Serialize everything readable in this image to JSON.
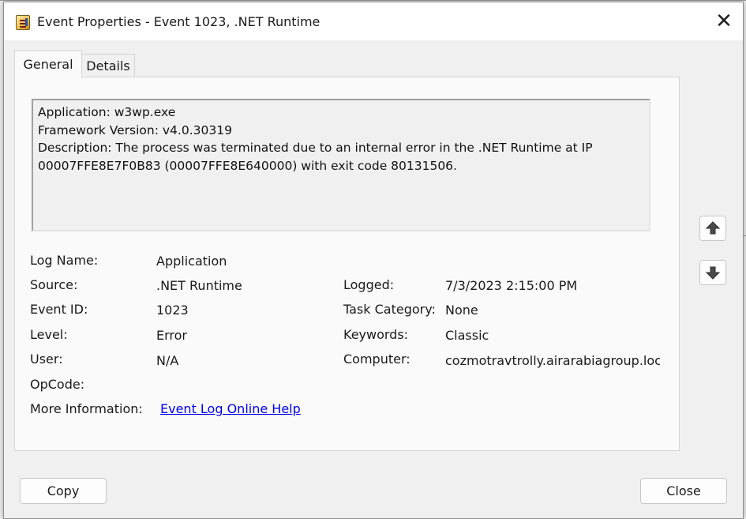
{
  "window": {
    "title": "Event Properties - Event 1023, .NET Runtime",
    "close_glyph": "✕"
  },
  "tabs": [
    {
      "label": "General",
      "active": true
    },
    {
      "label": "Details",
      "active": false
    }
  ],
  "description": {
    "lines": [
      "Application: w3wp.exe",
      "Framework Version: v4.0.30319",
      "Description: The process was terminated due to an internal error in the .NET Runtime at IP",
      "00007FFE8E7F0B83 (00007FFE8E640000) with exit code 80131506."
    ]
  },
  "fields": {
    "log_name": {
      "label": "Log Name:",
      "value": "Application"
    },
    "source": {
      "label": "Source:",
      "value": ".NET Runtime"
    },
    "logged": {
      "label": "Logged:",
      "value": "7/3/2023 2:15:00 PM"
    },
    "event_id": {
      "label": "Event ID:",
      "value": "1023"
    },
    "task_category": {
      "label": "Task Category:",
      "value": "None"
    },
    "level": {
      "label": "Level:",
      "value": "Error"
    },
    "keywords": {
      "label": "Keywords:",
      "value": "Classic"
    },
    "user": {
      "label": "User:",
      "value": "N/A"
    },
    "computer": {
      "label": "Computer:",
      "value": "cozmotravtrolly.airarabiagroup.local"
    },
    "opcode": {
      "label": "OpCode:",
      "value": ""
    },
    "more_info": {
      "label": "More Information:",
      "link_text": "Event Log Online Help"
    }
  },
  "nav": {
    "up_icon": "arrow-up-icon",
    "down_icon": "arrow-down-icon"
  },
  "buttons": {
    "copy": "Copy",
    "close": "Close"
  },
  "colors": {
    "link": "#0000ee",
    "panel": "#fafafa",
    "window": "#f0f0f0"
  }
}
